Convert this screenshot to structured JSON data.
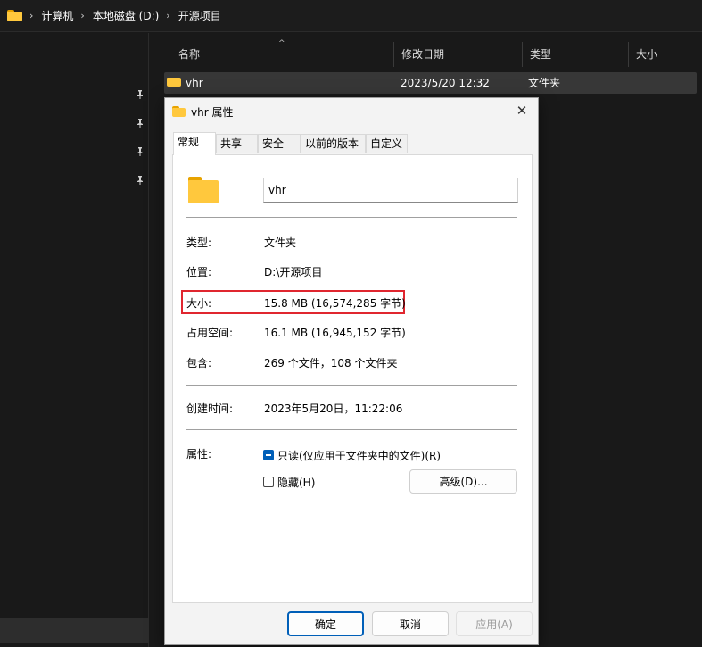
{
  "address": {
    "crumbs": [
      "计算机",
      "本地磁盘 (D:)",
      "开源项目"
    ],
    "separator": "›"
  },
  "list": {
    "columns": [
      "名称",
      "修改日期",
      "类型",
      "大小"
    ],
    "sort_indicator": "^",
    "rows": [
      {
        "name": "vhr",
        "date": "2023/5/20 12:32",
        "type": "文件夹",
        "size": ""
      }
    ]
  },
  "icons": {
    "pin": "pin-icon",
    "folder": "folder-icon",
    "close": "close-icon"
  },
  "dialog": {
    "title": "vhr 属性",
    "close_glyph": "✕",
    "tabs": [
      "常规",
      "共享",
      "安全",
      "以前的版本",
      "自定义"
    ],
    "active_tab": "常规",
    "name_value": "vhr",
    "props": {
      "type_label": "类型:",
      "type_value": "文件夹",
      "location_label": "位置:",
      "location_value": "D:\\开源项目",
      "size_label": "大小:",
      "size_value": "15.8 MB (16,574,285 字节)",
      "disk_label": "占用空间:",
      "disk_value": "16.1 MB (16,945,152 字节)",
      "contains_label": "包含:",
      "contains_value": "269 个文件，108 个文件夹",
      "created_label": "创建时间:",
      "created_value": "2023年5月20日，11:22:06",
      "attrs_label": "属性:"
    },
    "readonly_label": "只读(仅应用于文件夹中的文件)(R)",
    "readonly_state": "indeterminate",
    "hidden_label": "隐藏(H)",
    "hidden_state": "unchecked",
    "advanced_label": "高级(D)...",
    "ok_label": "确定",
    "cancel_label": "取消",
    "apply_label": "应用(A)"
  },
  "colors": {
    "highlight_border": "#e0262f",
    "accent": "#005fb8",
    "folder": "#ffc83d"
  }
}
